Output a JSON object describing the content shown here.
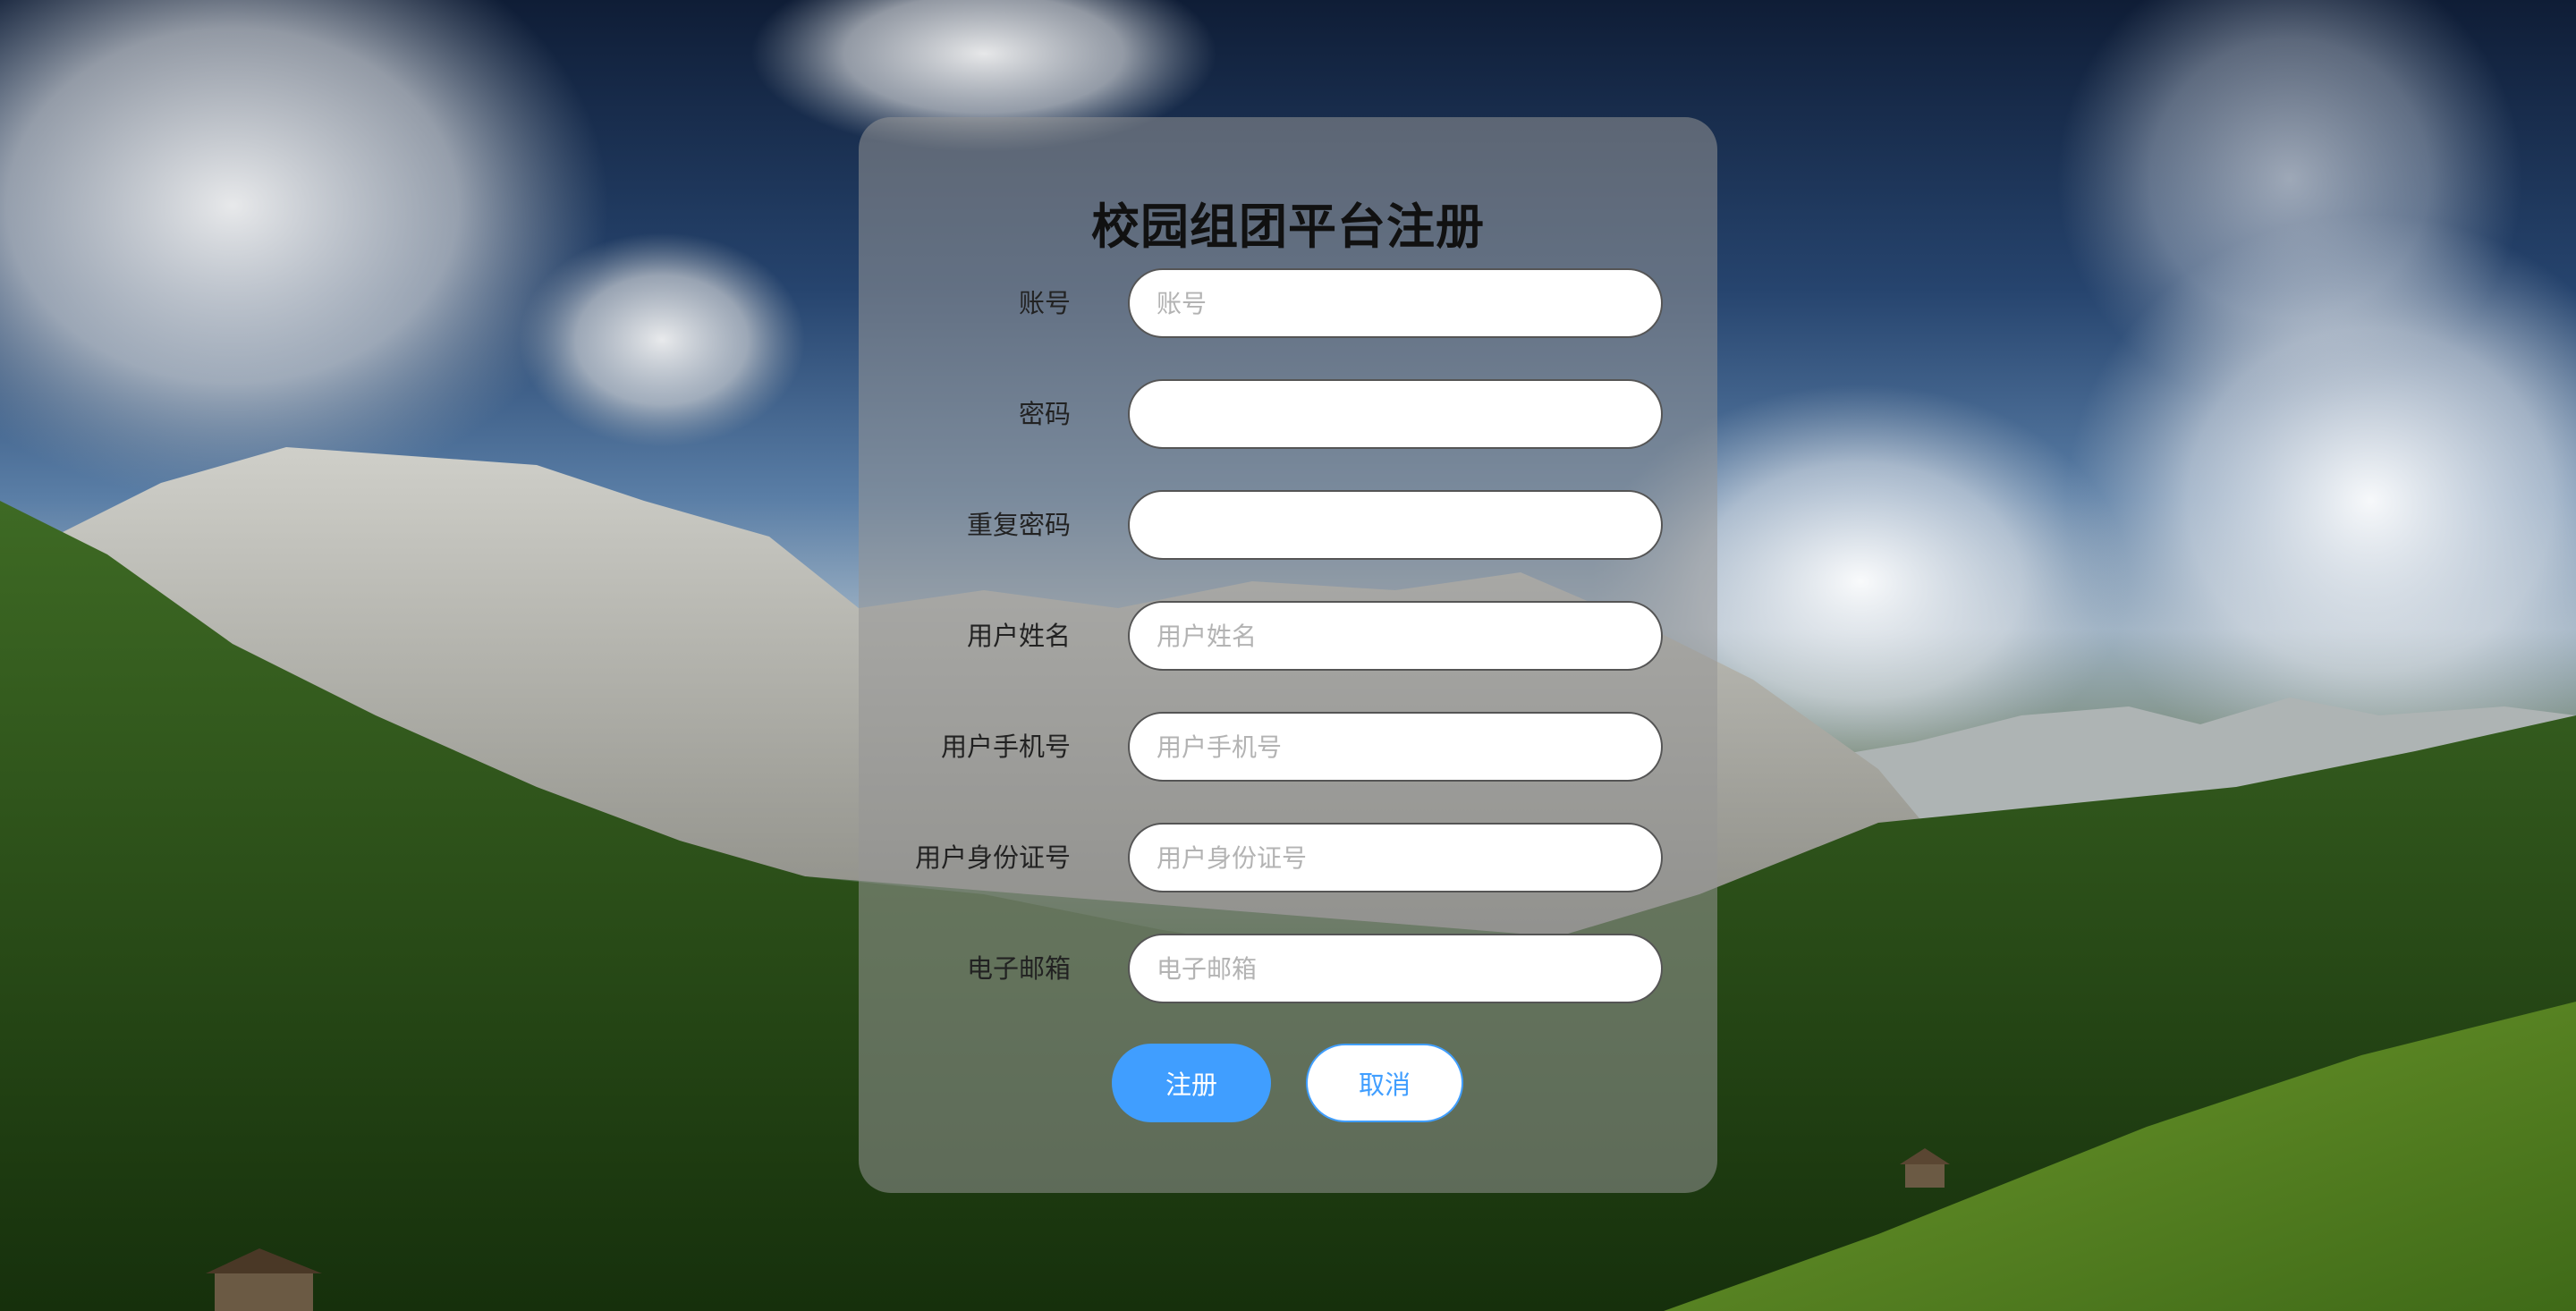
{
  "page": {
    "title": "校园组团平台注册"
  },
  "form": {
    "fields": [
      {
        "label": "账号",
        "placeholder": "账号",
        "type": "text"
      },
      {
        "label": "密码",
        "placeholder": "",
        "type": "password"
      },
      {
        "label": "重复密码",
        "placeholder": "",
        "type": "password"
      },
      {
        "label": "用户姓名",
        "placeholder": "用户姓名",
        "type": "text"
      },
      {
        "label": "用户手机号",
        "placeholder": "用户手机号",
        "type": "text"
      },
      {
        "label": "用户身份证号",
        "placeholder": "用户身份证号",
        "type": "text"
      },
      {
        "label": "电子邮箱",
        "placeholder": "电子邮箱",
        "type": "text"
      }
    ],
    "register_label": "注册",
    "cancel_label": "取消"
  },
  "colors": {
    "primary": "#409eff",
    "card_background": "rgba(150,150,150,0.55)"
  }
}
